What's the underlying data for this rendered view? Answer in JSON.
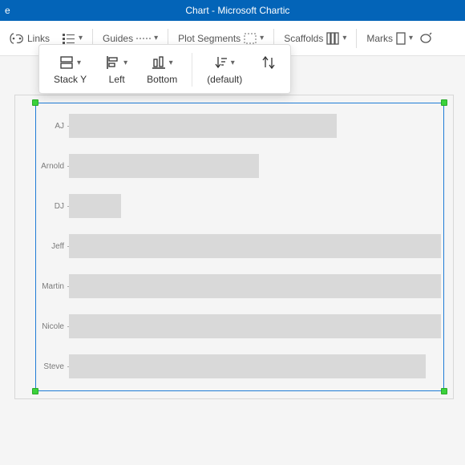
{
  "window": {
    "left_fragment": "e",
    "title": "Chart - Microsoft Chartic"
  },
  "toolbar": {
    "links": "Links",
    "guides": "Guides",
    "plot_segments": "Plot Segments",
    "scaffolds": "Scaffolds",
    "marks": "Marks"
  },
  "popup": {
    "stack_y": "Stack Y",
    "left": "Left",
    "bottom": "Bottom",
    "default": "(default)"
  },
  "chart_data": {
    "type": "bar",
    "orientation": "horizontal",
    "title": "",
    "xlabel": "",
    "ylabel": "",
    "xlim": [
      0,
      100
    ],
    "categories": [
      "AJ",
      "Arnold",
      "DJ",
      "Jeff",
      "Martin",
      "Nicole",
      "Steve"
    ],
    "values": [
      72,
      51,
      14,
      100,
      100,
      100,
      96
    ],
    "note": "Bars for Jeff, Martin, Nicole appear to extend to the full plot width (and possibly beyond the visible selection); values are estimated as fraction of plot width * 100."
  },
  "colors": {
    "brand": "#0364b8",
    "selection": "#1f7cd6",
    "handle": "#3bd23b",
    "bar": "#d9d9d9"
  }
}
